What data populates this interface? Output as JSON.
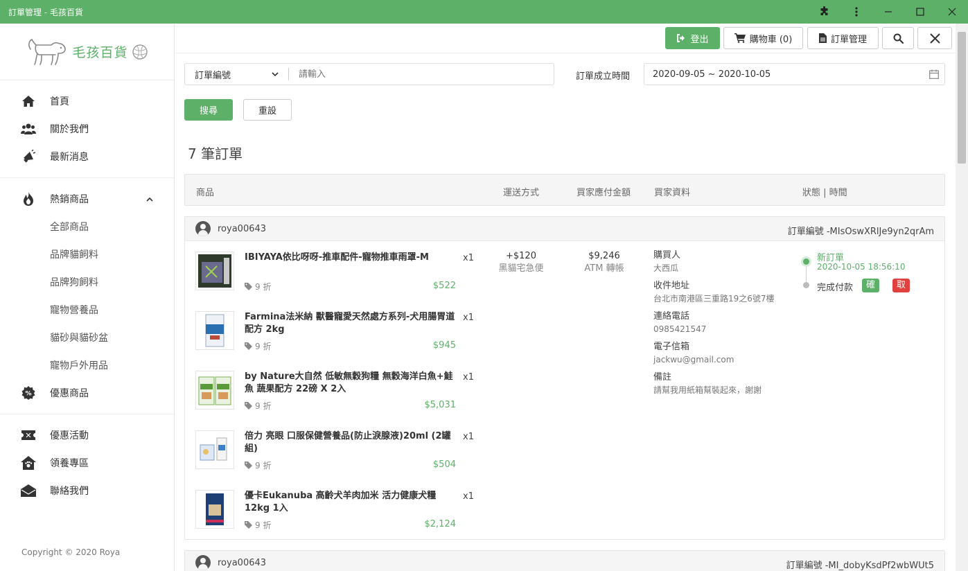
{
  "window": {
    "title": "訂單管理 - 毛孩百貨"
  },
  "brand": {
    "name": "毛孩百貨"
  },
  "sidebar": {
    "items": [
      {
        "label": "首頁",
        "icon": "home-icon"
      },
      {
        "label": "關於我們",
        "icon": "users-icon"
      },
      {
        "label": "最新消息",
        "icon": "bullhorn-icon"
      }
    ],
    "hot": {
      "label": "熱銷商品",
      "icon": "fire-icon"
    },
    "sub": [
      "全部商品",
      "品牌貓飼料",
      "品牌狗飼料",
      "寵物營養品",
      "貓砂與貓砂盆",
      "寵物戶外用品"
    ],
    "discount": {
      "label": "優惠商品",
      "icon": "percent-icon"
    },
    "bottom": [
      {
        "label": "優惠活動",
        "icon": "ticket-icon"
      },
      {
        "label": "領養專區",
        "icon": "house-paw-icon"
      },
      {
        "label": "聯絡我們",
        "icon": "envelope-icon"
      }
    ],
    "copyright": "Copyright © 2020 Roya"
  },
  "topbar": {
    "logout": "登出",
    "cart": "購物車 (0)",
    "orders": "訂單管理"
  },
  "filter": {
    "type_selected": "訂單編號",
    "search_placeholder": "請輸入",
    "date_label": "訂單成立時間",
    "date_range": "2020-09-05 ~ 2020-10-05",
    "search_btn": "搜尋",
    "reset_btn": "重設"
  },
  "count_text": "7 筆訂單",
  "table_headers": {
    "product": "商品",
    "shipping": "運送方式",
    "amount": "買家應付金額",
    "buyer": "買家資料",
    "status": "狀態 | 時間"
  },
  "orders": [
    {
      "user": "roya00643",
      "order_id": "訂單編號 -MIsOswXRlJe9yn2qrAm",
      "products": [
        {
          "name": "IBIYAYA依比呀呀-推車配件-寵物推車雨罩-M",
          "qty": "x1",
          "discount": "9 折",
          "price": "$522"
        },
        {
          "name": "Farmina法米納 獸醫寵愛天然處方系列-犬用腸胃道配方 2kg",
          "qty": "x1",
          "discount": "9 折",
          "price": "$945"
        },
        {
          "name": "by Nature大自然 低敏無穀狗糧 無穀海洋白魚+鮭魚 蔬果配方 22磅 X 2入",
          "qty": "x1",
          "discount": "9 折",
          "price": "$5,031"
        },
        {
          "name": "倍力 亮眼 口服保健營養品(防止淚腺液)20ml (2罐組)",
          "qty": "x1",
          "discount": "9 折",
          "price": "$504"
        },
        {
          "name": "優卡Eukanuba 高齡犬羊肉加米 活力健康犬糧12kg 1入",
          "qty": "x1",
          "discount": "9 折",
          "price": "$2,124"
        }
      ],
      "shipping": {
        "fee": "+$120",
        "method": "黑貓宅急便"
      },
      "payment": {
        "total": "$9,246",
        "method": "ATM 轉帳"
      },
      "buyer": {
        "buyer_label": "購買人",
        "buyer_name": "大西瓜",
        "addr_label": "收件地址",
        "addr": "台北市南港區三重路19之6號7樓",
        "phone_label": "連絡電話",
        "phone": "0985421547",
        "email_label": "電子信箱",
        "email": "jackwu@gmail.com",
        "note_label": "備註",
        "note": "請幫我用紙箱幫裝起來，謝謝"
      },
      "status": {
        "current": "新訂單",
        "time": "2020-10-05 18:56:10",
        "next": "完成付款",
        "confirm": "確定",
        "cancel": "取消"
      }
    },
    {
      "user": "roya00643",
      "order_id": "訂單編號 -MI_dobyKsdPf2wbWUt5"
    }
  ],
  "colors": {
    "primary": "#5cb068",
    "danger": "#e0413e"
  }
}
